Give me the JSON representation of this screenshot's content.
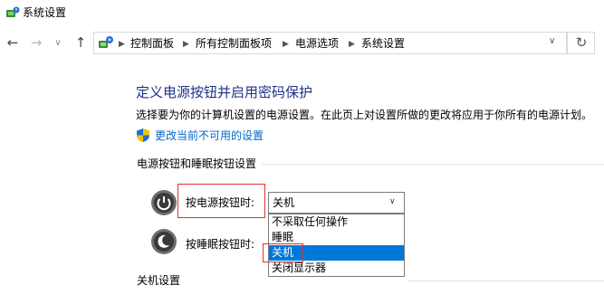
{
  "window": {
    "title": "系统设置"
  },
  "address_bar": {
    "crumbs": [
      "控制面板",
      "所有控制面板项",
      "电源选项",
      "系统设置"
    ]
  },
  "main": {
    "heading": "定义电源按钮并启用密码保护",
    "description": "选择要为你的计算机设置的电源设置。在此页上对设置所做的更改将应用于你所有的电源计划。",
    "change_link": "更改当前不可用的设置",
    "section_buttons": "电源按钮和睡眠按钮设置",
    "power_button_label": "按电源按钮时:",
    "sleep_button_label": "按睡眠按钮时:",
    "power_button_value": "关机",
    "dropdown_options": [
      "不采取任何操作",
      "睡眠",
      "关机",
      "关闭显示器"
    ],
    "selected_option": "关机",
    "section_shutdown": "关机设置"
  },
  "colors": {
    "heading": "#1e3287",
    "link": "#0066cc",
    "highlight": "#0078d7",
    "annotation": "#e23030"
  },
  "icons": [
    "power-options-icon",
    "back-arrow-icon",
    "forward-arrow-icon",
    "chevron-down-icon",
    "up-arrow-icon",
    "refresh-icon",
    "shield-icon",
    "power-button-icon",
    "sleep-button-icon"
  ]
}
